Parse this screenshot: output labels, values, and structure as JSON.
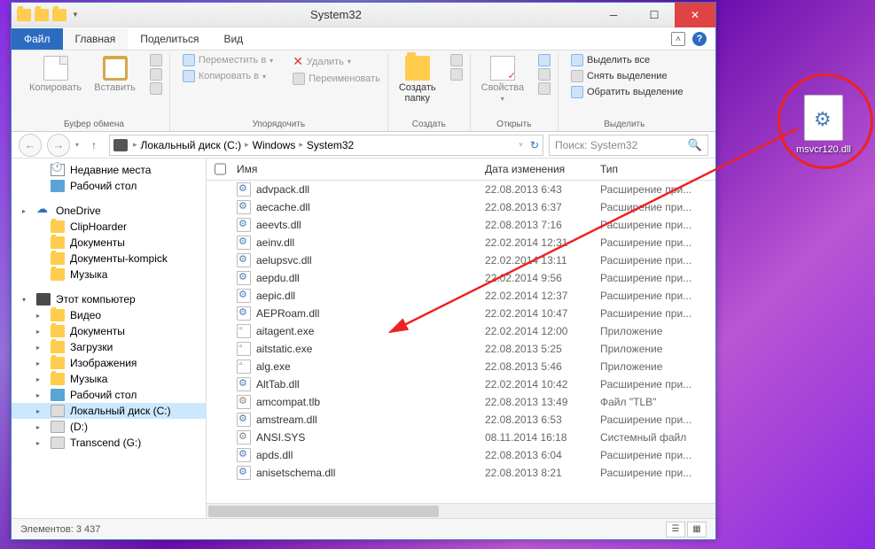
{
  "window": {
    "title": "System32",
    "tabs": {
      "file": "Файл",
      "home": "Главная",
      "share": "Поделиться",
      "view": "Вид"
    }
  },
  "ribbon": {
    "clipboard": {
      "copy": "Копировать",
      "paste": "Вставить",
      "label": "Буфер обмена"
    },
    "organize": {
      "move": "Переместить в",
      "copy": "Копировать в",
      "delete": "Удалить",
      "rename": "Переименовать",
      "label": "Упорядочить"
    },
    "new": {
      "folder": "Создать\nпапку",
      "label": "Создать"
    },
    "open": {
      "props": "Свойства",
      "label": "Открыть"
    },
    "select": {
      "all": "Выделить все",
      "none": "Снять выделение",
      "invert": "Обратить выделение",
      "label": "Выделить"
    }
  },
  "breadcrumb": {
    "root": "Локальный диск (C:)",
    "p2": "Windows",
    "p3": "System32"
  },
  "search": {
    "placeholder": "Поиск: System32"
  },
  "sidebar": {
    "recent": "Недавние места",
    "desktop": "Рабочий стол",
    "onedrive": "OneDrive",
    "cliphoarder": "ClipHoarder",
    "docs": "Документы",
    "docsk": "Документы-kompick",
    "music": "Музыка",
    "thispc": "Этот компьютер",
    "video": "Видео",
    "docs2": "Документы",
    "downloads": "Загрузки",
    "pictures": "Изображения",
    "music2": "Музыка",
    "desktop2": "Рабочий стол",
    "cdrive": "Локальный диск (C:)",
    "ddrive": "(D:)",
    "transcend": "Transcend (G:)"
  },
  "columns": {
    "name": "Имя",
    "date": "Дата изменения",
    "type": "Тип"
  },
  "files": [
    {
      "n": "advpack.dll",
      "d": "22.08.2013 6:43",
      "t": "Расширение при...",
      "k": "dll"
    },
    {
      "n": "aecache.dll",
      "d": "22.08.2013 6:37",
      "t": "Расширение при...",
      "k": "dll"
    },
    {
      "n": "aeevts.dll",
      "d": "22.08.2013 7:16",
      "t": "Расширение при...",
      "k": "dll"
    },
    {
      "n": "aeinv.dll",
      "d": "22.02.2014 12:31",
      "t": "Расширение при...",
      "k": "dll"
    },
    {
      "n": "aelupsvc.dll",
      "d": "22.02.2014 13:11",
      "t": "Расширение при...",
      "k": "dll"
    },
    {
      "n": "aepdu.dll",
      "d": "22.02.2014 9:56",
      "t": "Расширение при...",
      "k": "dll"
    },
    {
      "n": "aepic.dll",
      "d": "22.02.2014 12:37",
      "t": "Расширение при...",
      "k": "dll"
    },
    {
      "n": "AEPRoam.dll",
      "d": "22.02.2014 10:47",
      "t": "Расширение при...",
      "k": "dll"
    },
    {
      "n": "aitagent.exe",
      "d": "22.02.2014 12:00",
      "t": "Приложение",
      "k": "exe"
    },
    {
      "n": "aitstatic.exe",
      "d": "22.08.2013 5:25",
      "t": "Приложение",
      "k": "exe"
    },
    {
      "n": "alg.exe",
      "d": "22.08.2013 5:46",
      "t": "Приложение",
      "k": "exe"
    },
    {
      "n": "AltTab.dll",
      "d": "22.02.2014 10:42",
      "t": "Расширение при...",
      "k": "dll"
    },
    {
      "n": "amcompat.tlb",
      "d": "22.08.2013 13:49",
      "t": "Файл \"TLB\"",
      "k": "sys"
    },
    {
      "n": "amstream.dll",
      "d": "22.08.2013 6:53",
      "t": "Расширение при...",
      "k": "dll"
    },
    {
      "n": "ANSI.SYS",
      "d": "08.11.2014 16:18",
      "t": "Системный файл",
      "k": "sys"
    },
    {
      "n": "apds.dll",
      "d": "22.08.2013 6:04",
      "t": "Расширение при...",
      "k": "dll"
    },
    {
      "n": "anisetschema.dll",
      "d": "22.08.2013 8:21",
      "t": "Расширение при...",
      "k": "dll"
    }
  ],
  "status": {
    "elements": "Элементов: 3 437"
  },
  "desktop_file": {
    "label": "msvcr120.dll"
  }
}
